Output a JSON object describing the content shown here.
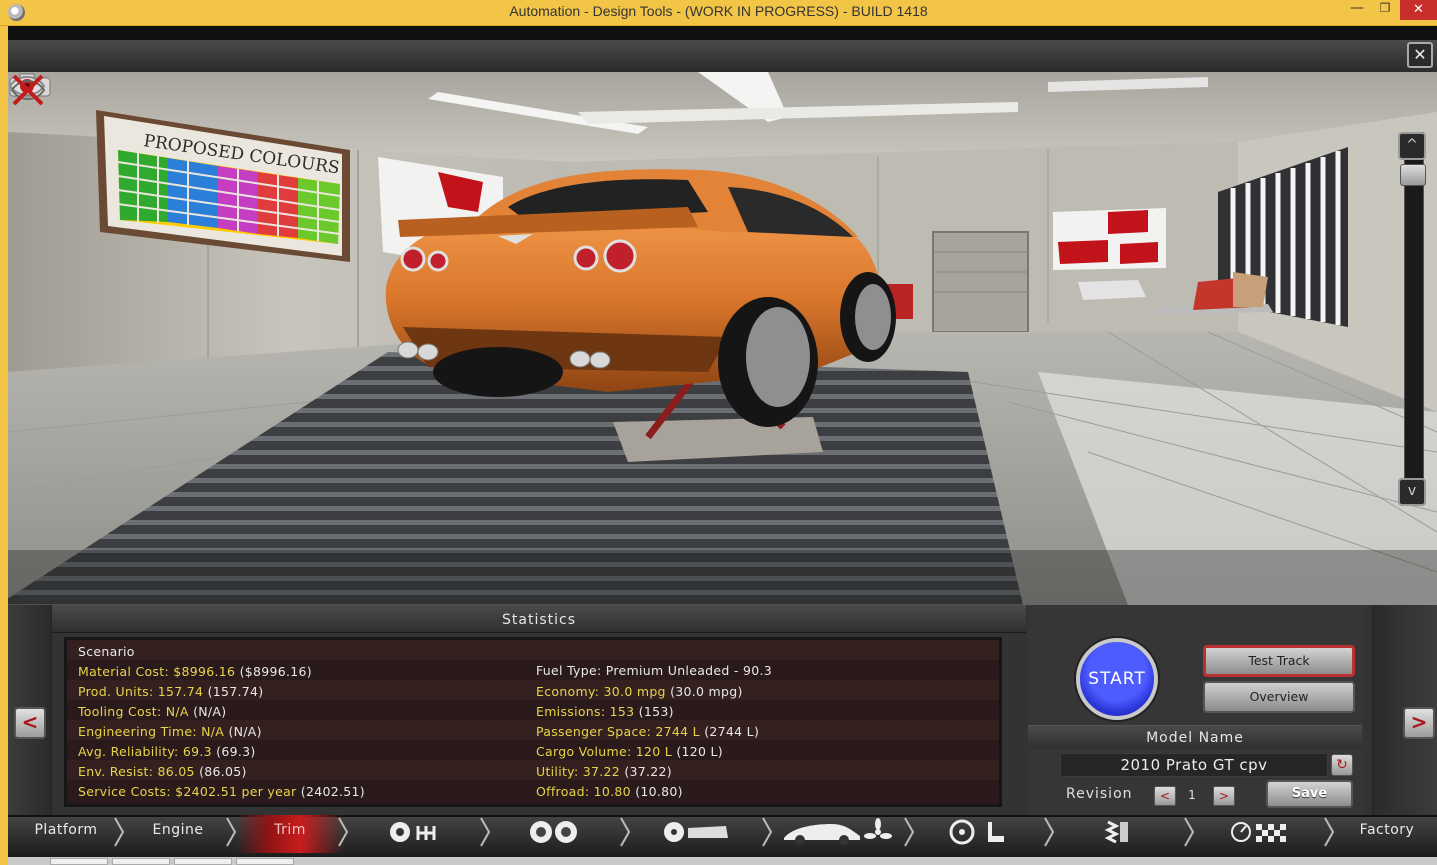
{
  "window": {
    "title": "Automation - Design Tools - (WORK IN PROGRESS) - BUILD 1418",
    "minimize": "—",
    "maximize": "❐",
    "close": "✕"
  },
  "viewport": {
    "close_label": "✕",
    "poster_title": "PROPOSED COLOURS",
    "car_color": "#d9762c",
    "up_label": "^",
    "down_label": "v"
  },
  "statistics": {
    "header": "Statistics",
    "scenario_label": "Scenario",
    "left": [
      {
        "label": "Material Cost: $8996.16",
        "paren": "($8996.16)"
      },
      {
        "label": "Prod. Units: 157.74",
        "paren": "(157.74)"
      },
      {
        "label": "Tooling Cost: N/A",
        "paren": "(N/A)"
      },
      {
        "label": "Engineering Time: N/A",
        "paren": "(N/A)"
      },
      {
        "label": "Avg. Reliability: 69.3",
        "paren": "(69.3)"
      },
      {
        "label": "Env. Resist: 86.05",
        "paren": "(86.05)"
      },
      {
        "label": "Service Costs: $2402.51 per year",
        "paren": "(2402.51)"
      }
    ],
    "fuel_type": "Fuel Type: Premium Unleaded - 90.3",
    "right": [
      {
        "label": "Economy: 30.0 mpg",
        "paren": "(30.0 mpg)"
      },
      {
        "label": "Emissions: 153",
        "paren": "(153)"
      },
      {
        "label": "Passenger Space: 2744 L",
        "paren": "(2744 L)"
      },
      {
        "label": "Cargo Volume: 120 L",
        "paren": "(120 L)"
      },
      {
        "label": "Utility: 37.22",
        "paren": "(37.22)"
      },
      {
        "label": "Offroad: 10.80",
        "paren": "(10.80)"
      }
    ]
  },
  "actions": {
    "start": "START",
    "test_track": "Test Track",
    "overview": "Overview",
    "model_name_header": "Model Name",
    "model_name": "2010 Prato GT cpv",
    "revision_label": "Revision",
    "revision_value": "1",
    "rev_prev": "<",
    "rev_next": ">",
    "save": "Save",
    "nav_prev": "<",
    "nav_next": ">"
  },
  "nav": {
    "platform": "Platform",
    "engine": "Engine",
    "trim": "Trim",
    "factory": "Factory"
  },
  "colors": {
    "titlebar": "#f3c546",
    "stat_yellow": "#e7d44a",
    "start_blue": "#3442e8",
    "active_tab_red": "#c81c1c"
  }
}
